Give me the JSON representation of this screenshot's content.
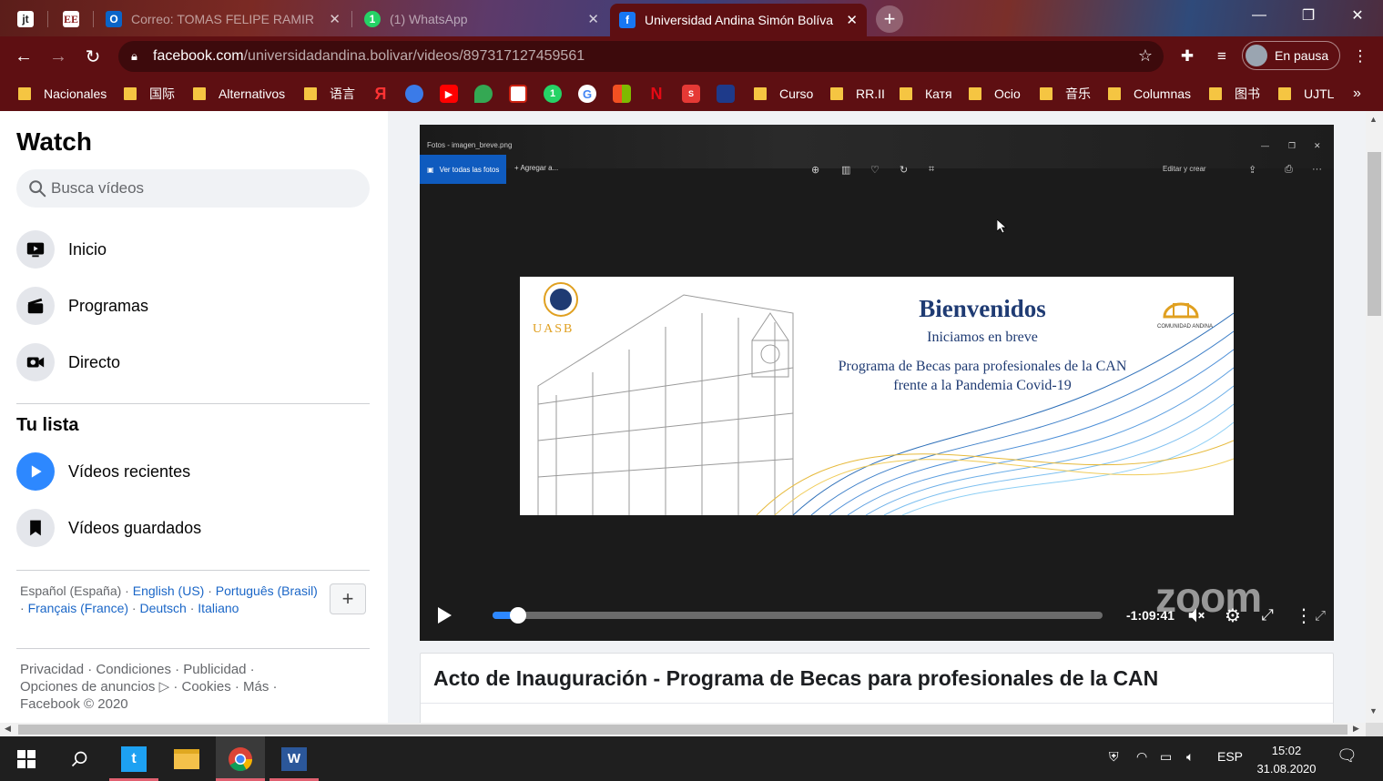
{
  "browser": {
    "tabs": [
      {
        "label": "jt",
        "pinned": true
      },
      {
        "label": "EE",
        "pinned": true
      },
      {
        "label": "Correo: TOMAS FELIPE RAMIREZ"
      },
      {
        "label": "(1) WhatsApp"
      },
      {
        "label": "Universidad Andina Simón Bolíva",
        "active": true
      }
    ],
    "url_domain": "facebook.com",
    "url_path": "/universidadandina.bolivar/videos/897317127459561",
    "profile_label": "En pausa",
    "bookmarks": {
      "nacionales": "Nacionales",
      "guoji": "国际",
      "alternativos": "Alternativos",
      "yuyan": "语言",
      "yandex": "Я",
      "curso": "Curso",
      "rrii": "RR.II",
      "katya": "Катя",
      "ocio": "Ocio",
      "yinyue": "音乐",
      "columnas": "Columnas",
      "tushu": "图书",
      "ujtl": "UJTL",
      "more": "»"
    }
  },
  "sidebar": {
    "title": "Watch",
    "search_placeholder": "Busca vídeos",
    "nav": {
      "inicio": "Inicio",
      "programas": "Programas",
      "directo": "Directo"
    },
    "list_title": "Tu lista",
    "list": {
      "recientes": "Vídeos recientes",
      "guardados": "Vídeos guardados"
    },
    "languages": {
      "current": "Español (España)",
      "english": "English (US)",
      "portugues": "Português (Brasil)",
      "francais": "Français (France)",
      "deutsch": "Deutsch",
      "italiano": "Italiano"
    },
    "footer": {
      "privacidad": "Privacidad",
      "condiciones": "Condiciones",
      "publicidad": "Publicidad",
      "opciones": "Opciones de anuncios",
      "cookies": "Cookies",
      "mas": "Más",
      "copyright": "Facebook © 2020"
    }
  },
  "video": {
    "photos_app_title": "Fotos - imagen_breve.png",
    "photos_view_all": "Ver todas las fotos",
    "photos_add": "Agregar a...",
    "photos_edit": "Editar y crear",
    "banner": {
      "title": "Bienvenidos",
      "subtitle": "Iniciamos en breve",
      "program_line1": "Programa de Becas para profesionales de la CAN",
      "program_line2": "frente a la Pandemia Covid-19",
      "logo_left": "UASB",
      "logo_right": "COMUNIDAD ANDINA"
    },
    "watermark": "zoom",
    "time_remaining": "-1:09:41",
    "progress_fraction": 0.035,
    "title": "Acto de Inauguración - Programa de Becas para profesionales de la CAN"
  },
  "taskbar": {
    "language": "ESP",
    "time": "15:02",
    "date": "31.08.2020"
  }
}
